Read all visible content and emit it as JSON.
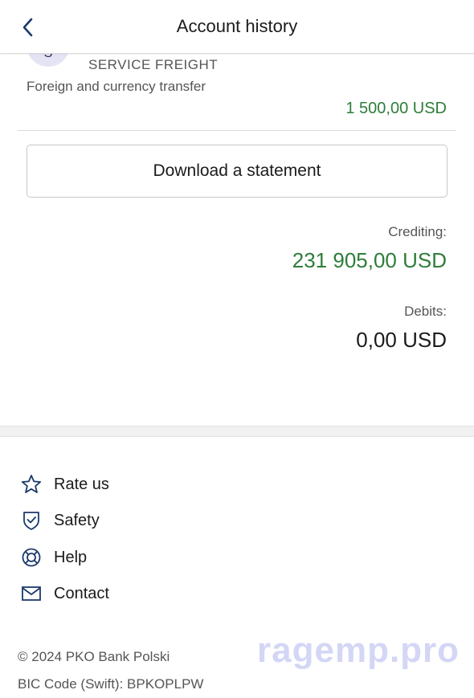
{
  "header": {
    "title": "Account history",
    "back_icon": "chevron-left-icon"
  },
  "transaction": {
    "avatar_letter": "S",
    "name": "SERVICE FREIGHT",
    "type": "Foreign and currency transfer",
    "amount": "1 500,00 USD"
  },
  "download_label": "Download a statement",
  "summary": {
    "crediting_label": "Crediting:",
    "crediting_value": "231 905,00 USD",
    "debits_label": "Debits:",
    "debits_value": "0,00 USD"
  },
  "menu": [
    {
      "label": "Rate us",
      "icon": "star-icon"
    },
    {
      "label": "Safety",
      "icon": "shield-icon"
    },
    {
      "label": "Help",
      "icon": "lifebuoy-icon"
    },
    {
      "label": "Contact",
      "icon": "envelope-icon"
    }
  ],
  "footer": {
    "copyright": "© 2024 PKO Bank Polski",
    "bic": "BIC Code (Swift): BPKOPLPW"
  },
  "watermark": "ragemp.pro",
  "colors": {
    "accent": "#1b3a6b",
    "credit": "#2e7d3a"
  }
}
